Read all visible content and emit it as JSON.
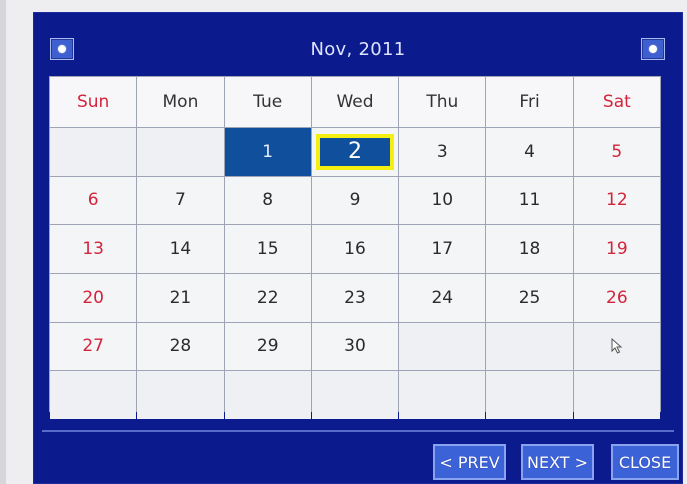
{
  "calendar": {
    "title": "Nov, 2011",
    "weekdays": [
      "Sun",
      "Mon",
      "Tue",
      "Wed",
      "Thu",
      "Fri",
      "Sat"
    ],
    "weeks": [
      [
        "",
        "",
        "1",
        "2",
        "3",
        "4",
        "5"
      ],
      [
        "6",
        "7",
        "8",
        "9",
        "10",
        "11",
        "12"
      ],
      [
        "13",
        "14",
        "15",
        "16",
        "17",
        "18",
        "19"
      ],
      [
        "20",
        "21",
        "22",
        "23",
        "24",
        "25",
        "26"
      ],
      [
        "27",
        "28",
        "29",
        "30",
        "",
        "",
        ""
      ],
      [
        "",
        "",
        "",
        "",
        "",
        "",
        ""
      ]
    ],
    "selected_day": "1",
    "focused_day": "2"
  },
  "buttons": {
    "prev": "< PREV",
    "next": "NEXT >",
    "close": "CLOSE"
  },
  "icons": {
    "corner_left": "option-dot-icon",
    "corner_right": "option-dot-icon",
    "pointer": "mouse-pointer-icon"
  },
  "colors": {
    "dialog_bg": "#0b1a8c",
    "weekend_text": "#d2243a",
    "selected_bg": "#0f4f9c",
    "focus_border": "#f2ef11",
    "button_bg": "#3c62d8"
  }
}
